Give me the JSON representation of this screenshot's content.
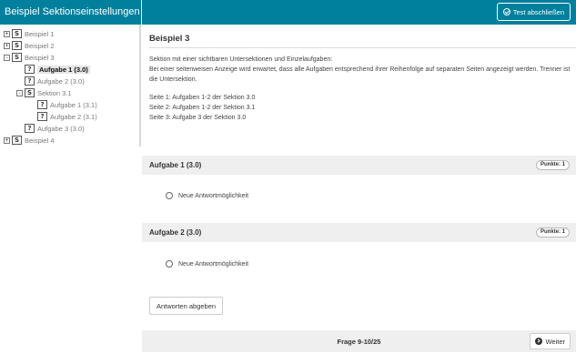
{
  "sidebar": {
    "title": "Beispiel Sektionseinstellungen",
    "tree": [
      {
        "toggle": "+",
        "icon": "S",
        "label": "Beispiel 1",
        "active": false
      },
      {
        "toggle": "+",
        "icon": "S",
        "label": "Beispiel 2",
        "active": false
      },
      {
        "toggle": "-",
        "icon": "S",
        "label": "Beispiel 3",
        "active": false
      },
      {
        "toggle": "",
        "icon": "?",
        "label": "Aufgabe 1 (3.0)",
        "active": true
      },
      {
        "toggle": "",
        "icon": "?",
        "label": "Aufgabe 2 (3.0)",
        "active": false
      },
      {
        "toggle": "-",
        "icon": "S",
        "label": "Sektion 3.1",
        "active": false
      },
      {
        "toggle": "",
        "icon": "?",
        "label": "Aufgabe 1 (3.1)",
        "active": false
      },
      {
        "toggle": "",
        "icon": "?",
        "label": "Aufgabe 2 (3.1)",
        "active": false
      },
      {
        "toggle": "",
        "icon": "?",
        "label": "Aufgabe 3 (3.0)",
        "active": false
      },
      {
        "toggle": "+",
        "icon": "S",
        "label": "Beispiel 4",
        "active": false
      }
    ]
  },
  "topbar": {
    "finish_label": "Test abschließen",
    "finish_icon": "check-circle-icon"
  },
  "main": {
    "title": "Beispiel 3",
    "description_1": "Sektion mit einer sichtbaren Untersektionen und Einzelaufgaben:",
    "description_2": "Bei einer seitenweisen Anzeige wird erwartet, dass alle Aufgaben entsprechend ihrer Reihenfolge auf separaten Seiten angezeigt werden. Trenner ist die Untersektion.",
    "pages": [
      "Seite 1: Aufgaben 1-2 der Sektion 3.0",
      "Seite 2: Aufgaben 1-2 der Sektion 3.1",
      "Seite 3: Aufgabe 3 der Sektion 3.0"
    ],
    "questions": [
      {
        "title": "Aufgabe 1 (3.0)",
        "points": "Punkte: 1",
        "answer": "Neue Antwortmöglichkeit"
      },
      {
        "title": "Aufgabe 2 (3.0)",
        "points": "Punkte: 1",
        "answer": "Neue Antwortmöglichkeit"
      }
    ],
    "submit_label": "Antworten abgeben"
  },
  "footer": {
    "page_info": "Frage 9-10/25",
    "next_label": "Weiter",
    "next_icon": "arrow-right-circle-icon"
  },
  "colors": {
    "accent": "#00809d",
    "panel": "#efefef"
  }
}
